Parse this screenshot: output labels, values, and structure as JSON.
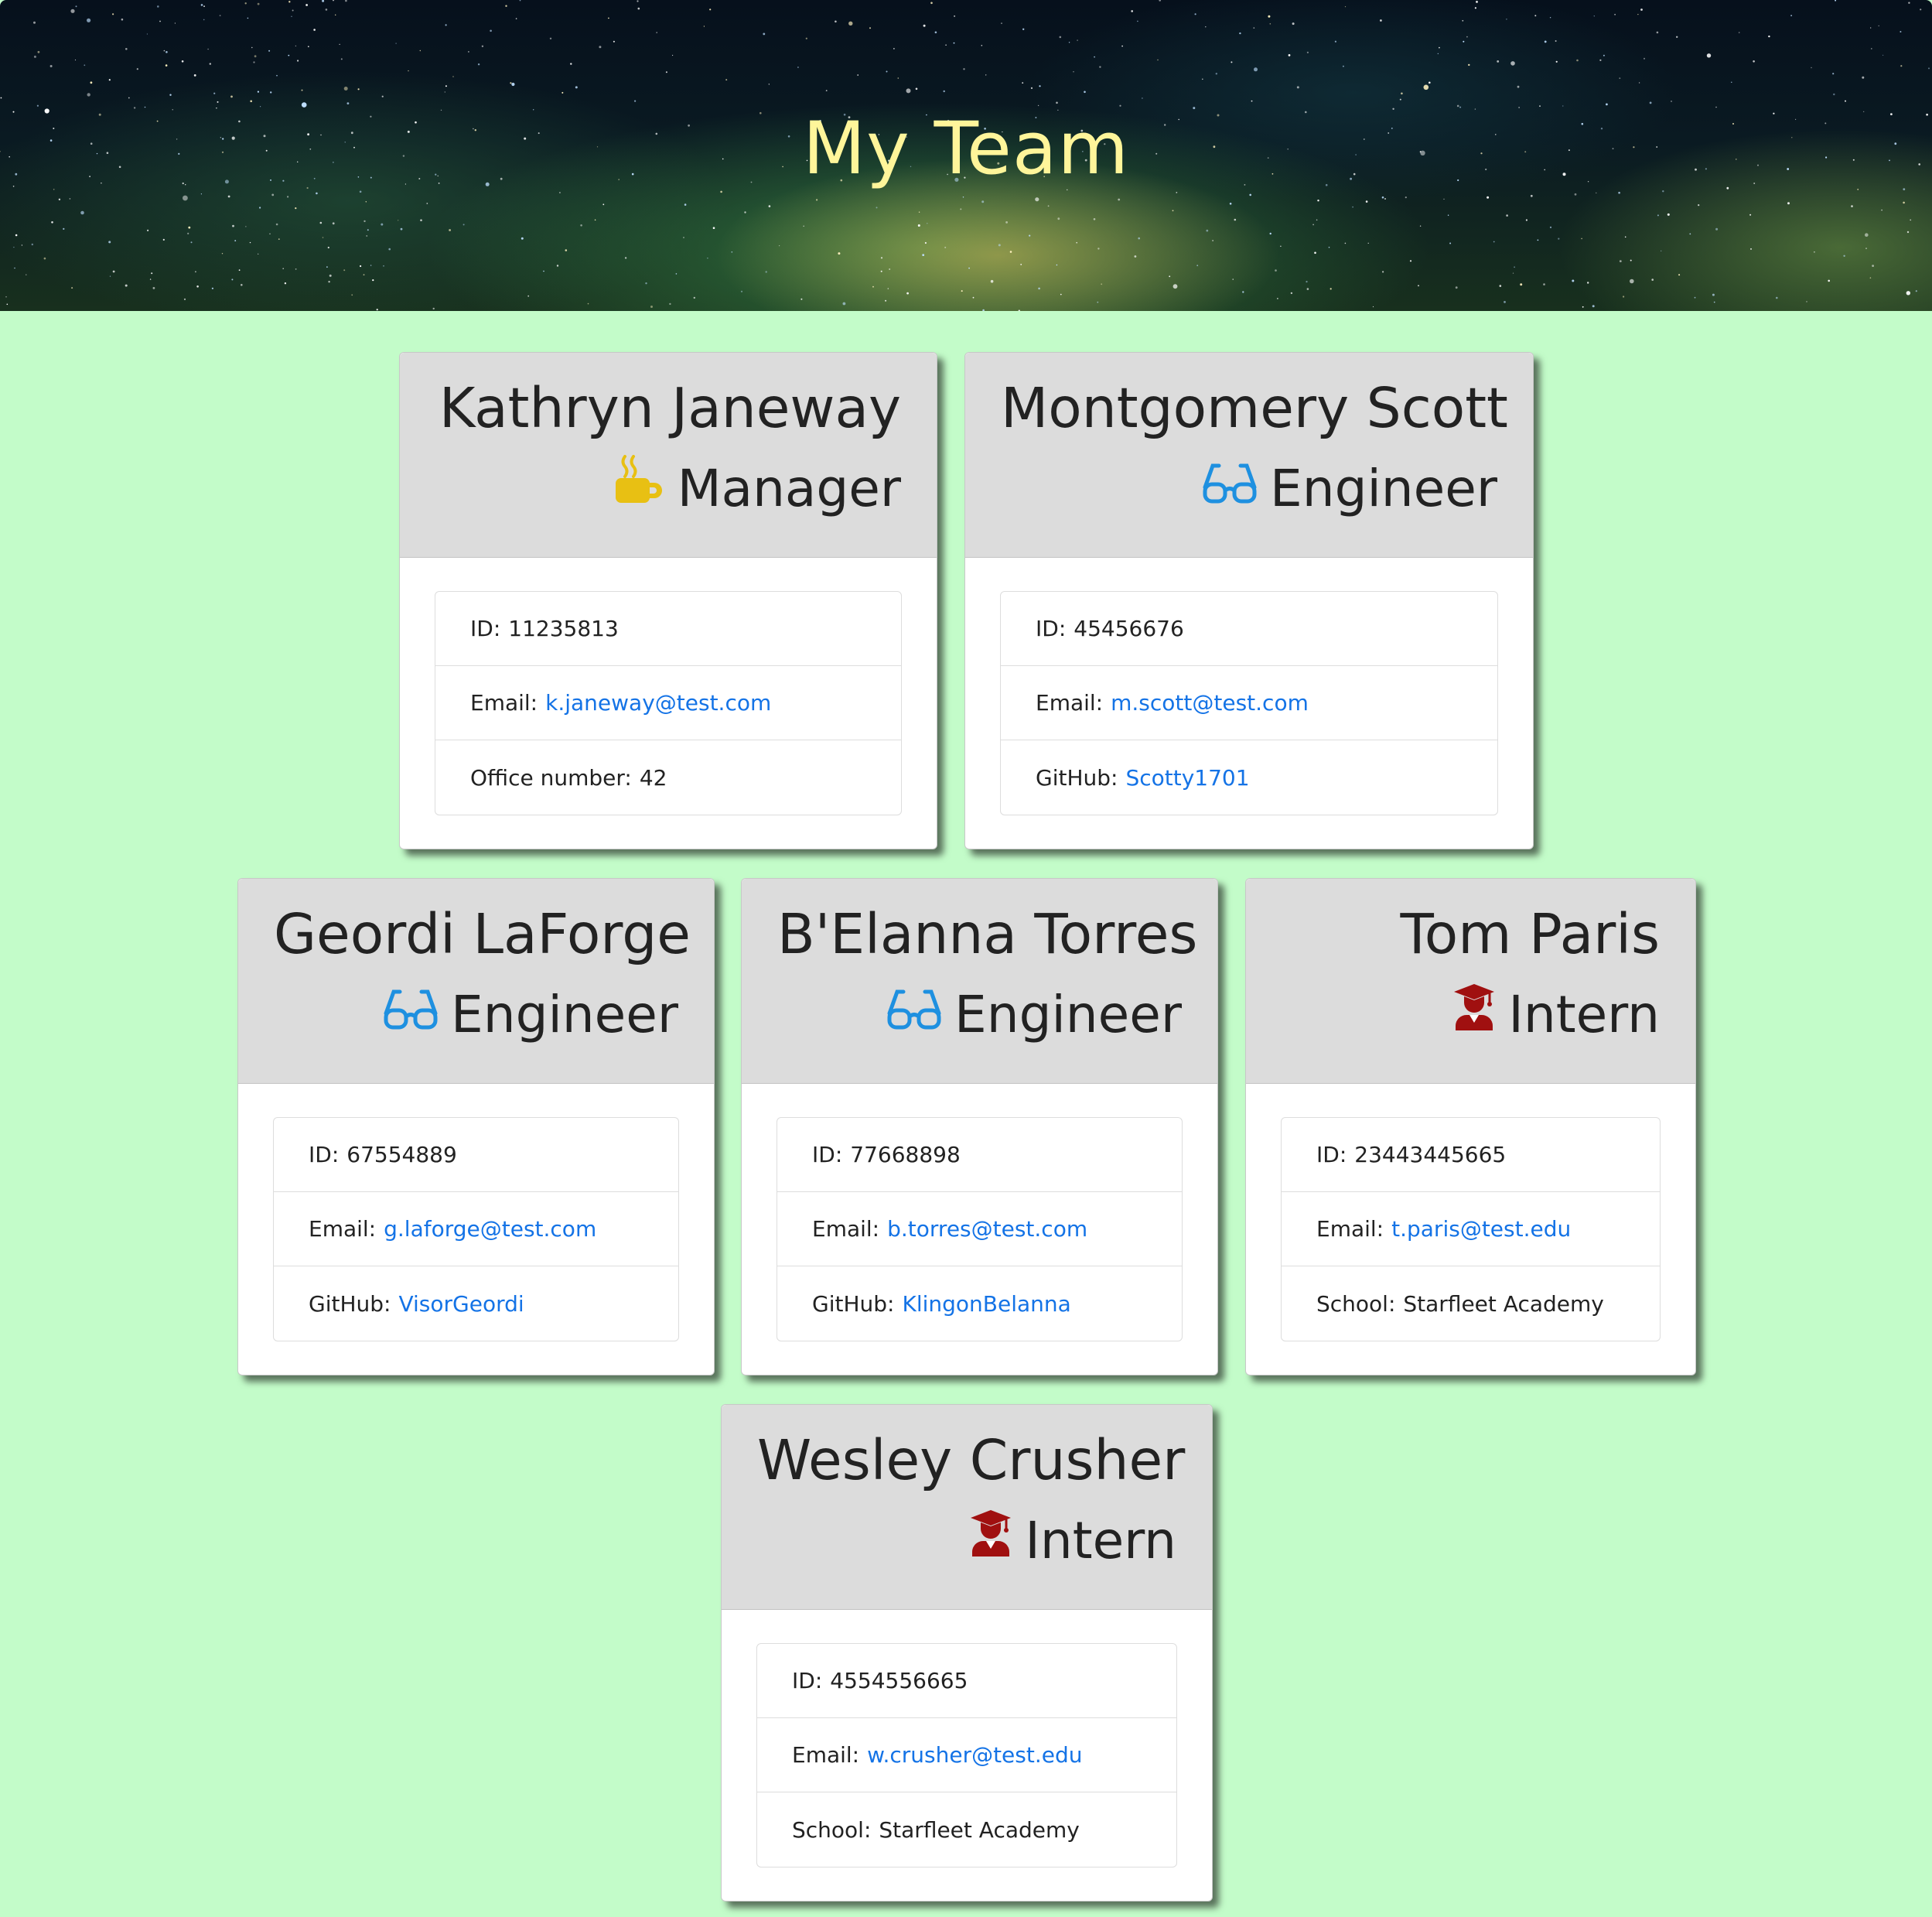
{
  "header": {
    "title": "My Team"
  },
  "colors": {
    "background": "#c3fcc9",
    "title": "#fff59a",
    "manager_icon": "#e8c013",
    "engineer_icon": "#1e90e0",
    "intern_icon": "#a01010",
    "link": "#1473e6"
  },
  "labels": {
    "id": "ID:",
    "email": "Email:",
    "office": "Office number:",
    "github": "GitHub:",
    "school": "School:"
  },
  "team": [
    {
      "name": "Kathryn Janeway",
      "role": "Manager",
      "icon": "mug-icon",
      "id": "11235813",
      "email": "k.janeway@test.com",
      "office": "42"
    },
    {
      "name": "Montgomery Scott",
      "role": "Engineer",
      "icon": "glasses-icon",
      "id": "45456676",
      "email": "m.scott@test.com",
      "github": "Scotty1701"
    },
    {
      "name": "Geordi LaForge",
      "role": "Engineer",
      "icon": "glasses-icon",
      "id": "67554889",
      "email": "g.laforge@test.com",
      "github": "VisorGeordi"
    },
    {
      "name": "B'Elanna Torres",
      "role": "Engineer",
      "icon": "glasses-icon",
      "id": "77668898",
      "email": "b.torres@test.com",
      "github": "KlingonBelanna"
    },
    {
      "name": "Tom Paris",
      "role": "Intern",
      "icon": "graduate-icon",
      "id": "23443445665",
      "email": "t.paris@test.edu",
      "school": "Starfleet Academy"
    },
    {
      "name": "Wesley Crusher",
      "role": "Intern",
      "icon": "graduate-icon",
      "id": "4554556665",
      "email": "w.crusher@test.edu",
      "school": "Starfleet Academy"
    }
  ]
}
